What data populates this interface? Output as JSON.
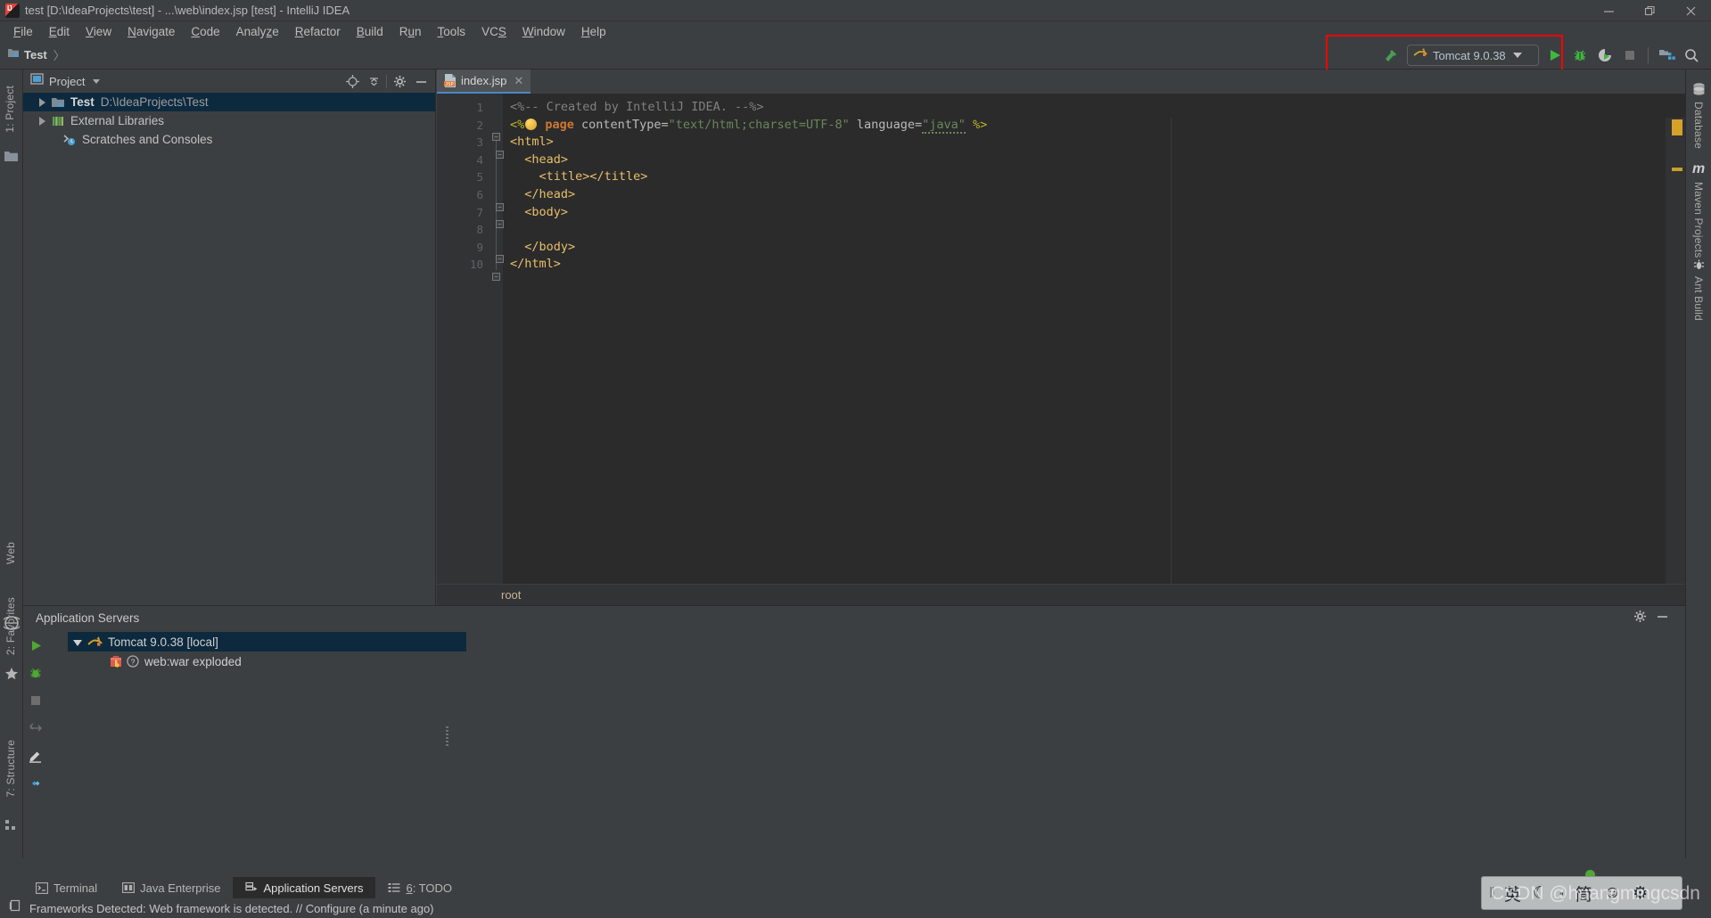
{
  "window": {
    "title": "test [D:\\IdeaProjects\\test] - ...\\web\\index.jsp [test] - IntelliJ IDEA",
    "logo_icon": "intellij-idea-logo-icon",
    "minimize_icon": "minimize-icon",
    "restore_icon": "restore-icon",
    "close_icon": "close-icon"
  },
  "menubar": {
    "items": [
      {
        "label": "File",
        "mnemonic": "F"
      },
      {
        "label": "Edit",
        "mnemonic": "E"
      },
      {
        "label": "View",
        "mnemonic": "V"
      },
      {
        "label": "Navigate",
        "mnemonic": "N"
      },
      {
        "label": "Code",
        "mnemonic": "C"
      },
      {
        "label": "Analyze",
        "mnemonic": "z"
      },
      {
        "label": "Refactor",
        "mnemonic": "R"
      },
      {
        "label": "Build",
        "mnemonic": "B"
      },
      {
        "label": "Run",
        "mnemonic": "u"
      },
      {
        "label": "Tools",
        "mnemonic": "T"
      },
      {
        "label": "VCS",
        "mnemonic": "S"
      },
      {
        "label": "Window",
        "mnemonic": "W"
      },
      {
        "label": "Help",
        "mnemonic": "H"
      }
    ]
  },
  "navbar": {
    "project_crumb": "Test",
    "project_icon": "module-folder-icon",
    "crumb_separator": "〉",
    "build_icon": "build-hammer-icon",
    "run_config": {
      "label": "Tomcat 9.0.38",
      "icon": "tomcat-cat-icon",
      "dropdown_icon": "chevron-down-icon"
    },
    "run_button_icon": "run-play-icon",
    "debug_button_icon": "debug-bug-icon",
    "coverage_button_icon": "run-with-coverage-icon",
    "stop_button_icon": "stop-square-icon",
    "project_structure_icon": "project-structure-icon",
    "search_icon": "search-icon",
    "highlight_color": "#ff0000"
  },
  "left_rail": {
    "tabs": [
      {
        "label": "1: Project",
        "icon": "project-folder-icon"
      },
      {
        "label": "Web",
        "icon": "web-globe-icon"
      },
      {
        "label": "2: Favorites",
        "icon": "favorites-star-icon"
      },
      {
        "label": "7: Structure",
        "icon": "structure-icon"
      }
    ]
  },
  "right_rail": {
    "tabs": [
      {
        "label": "Database",
        "icon": "database-icon"
      },
      {
        "label": "Maven Projects",
        "icon": "maven-m-icon"
      },
      {
        "label": "Ant Build",
        "icon": "ant-build-icon"
      }
    ]
  },
  "project_panel": {
    "title": "Project",
    "view_icon": "project-view-icon",
    "dropdown_icon": "chevron-down-icon",
    "locate_icon": "scroll-from-source-icon",
    "collapse_icon": "collapse-all-icon",
    "settings_icon": "gear-icon",
    "hide_icon": "hide-minimize-icon",
    "tree": [
      {
        "label": "Test",
        "sub": "D:\\IdeaProjects\\Test",
        "icon": "module-folder-icon",
        "expanded": false,
        "selected": true,
        "indent": 0
      },
      {
        "label": "External Libraries",
        "sub": "",
        "icon": "external-libraries-icon",
        "expanded": false,
        "selected": false,
        "indent": 0
      },
      {
        "label": "Scratches and Consoles",
        "sub": "",
        "icon": "scratches-consoles-icon",
        "expanded": false,
        "selected": false,
        "indent": 1
      }
    ]
  },
  "editor": {
    "tabs": [
      {
        "label": "index.jsp",
        "icon": "jsp-file-icon",
        "close_icon": "close-icon",
        "active": true
      }
    ],
    "breadcrumb": "root",
    "line_numbers": [
      "1",
      "2",
      "3",
      "4",
      "5",
      "6",
      "7",
      "8",
      "9",
      "10"
    ],
    "code_lines": [
      {
        "n": 1,
        "tokens": [
          {
            "t": "<%-- Created by IntelliJ IDEA. --%>",
            "c": "c-comment"
          }
        ]
      },
      {
        "n": 2,
        "tokens": [
          {
            "t": "<%",
            "c": "c-jsp"
          },
          {
            "t": " page ",
            "c": "c-kw"
          },
          {
            "t": "contentType=",
            "c": "c-attr"
          },
          {
            "t": "\"text/html;charset=UTF-8\"",
            "c": "c-str"
          },
          {
            "t": " language=",
            "c": "c-attr"
          },
          {
            "t": "\"java\"",
            "c": "c-str"
          },
          {
            "t": " %>",
            "c": "c-jsp"
          }
        ]
      },
      {
        "n": 3,
        "tokens": [
          {
            "t": "<html>",
            "c": "c-tag"
          }
        ]
      },
      {
        "n": 4,
        "tokens": [
          {
            "t": "  <head>",
            "c": "c-tag"
          }
        ]
      },
      {
        "n": 5,
        "tokens": [
          {
            "t": "    <title></title>",
            "c": "c-tag"
          }
        ]
      },
      {
        "n": 6,
        "tokens": [
          {
            "t": "  </head>",
            "c": "c-tag"
          }
        ]
      },
      {
        "n": 7,
        "tokens": [
          {
            "t": "  <body>",
            "c": "c-tag"
          }
        ]
      },
      {
        "n": 8,
        "tokens": [
          {
            "t": "",
            "c": "c-plain"
          }
        ]
      },
      {
        "n": 9,
        "tokens": [
          {
            "t": "  </body>",
            "c": "c-tag"
          }
        ]
      },
      {
        "n": 10,
        "tokens": [
          {
            "t": "</html>",
            "c": "c-tag"
          }
        ]
      }
    ],
    "inspection_widget_color": "#d6a12a"
  },
  "bottom_panel": {
    "title": "Application Servers",
    "settings_icon": "gear-icon",
    "hide_icon": "hide-minimize-icon",
    "side_actions": [
      {
        "icon": "run-play-icon",
        "name": "run"
      },
      {
        "icon": "debug-bug-icon",
        "name": "debug"
      },
      {
        "icon": "stop-square-icon",
        "name": "stop"
      },
      {
        "icon": "rerun-icon",
        "name": "rerun"
      },
      {
        "icon": "edit-pencil-icon",
        "name": "edit-configuration"
      },
      {
        "icon": "deploy-diamond-icon",
        "name": "deploy"
      }
    ],
    "tree": [
      {
        "label": "Tomcat 9.0.38 [local]",
        "icon": "tomcat-cat-icon",
        "expanded": true,
        "selected": true,
        "indent": 0
      },
      {
        "label": "web:war exploded",
        "icon": "artifact-icon",
        "status_icon": "question-mark-icon",
        "expanded": false,
        "selected": false,
        "indent": 1
      }
    ]
  },
  "bottom_tabs": [
    {
      "label": "Terminal",
      "icon": "terminal-icon",
      "active": false
    },
    {
      "label": "Java Enterprise",
      "icon": "java-enterprise-icon",
      "active": false
    },
    {
      "label": "Application Servers",
      "icon": "application-servers-icon",
      "active": true
    },
    {
      "label": "6: TODO",
      "icon": "todo-list-icon",
      "mnemonic": "6",
      "active": false
    }
  ],
  "statusbar": {
    "icon": "event-log-icon",
    "text": "Frameworks Detected: Web framework is detected. // Configure (a minute ago)"
  },
  "ime_bar": {
    "grip": "‖",
    "items": [
      {
        "glyph": "英",
        "name": "language-mode-english"
      },
      {
        "glyph": "☾",
        "name": "moon-icon"
      },
      {
        "glyph": "•",
        "name": "punctuation-icon"
      },
      {
        "glyph": "简",
        "name": "simplified-chinese-icon"
      },
      {
        "glyph": "☺",
        "name": "emoji-icon"
      },
      {
        "glyph": "⚙",
        "name": "gear-icon"
      }
    ]
  },
  "watermark": "CSDN @huangmingcsdn"
}
